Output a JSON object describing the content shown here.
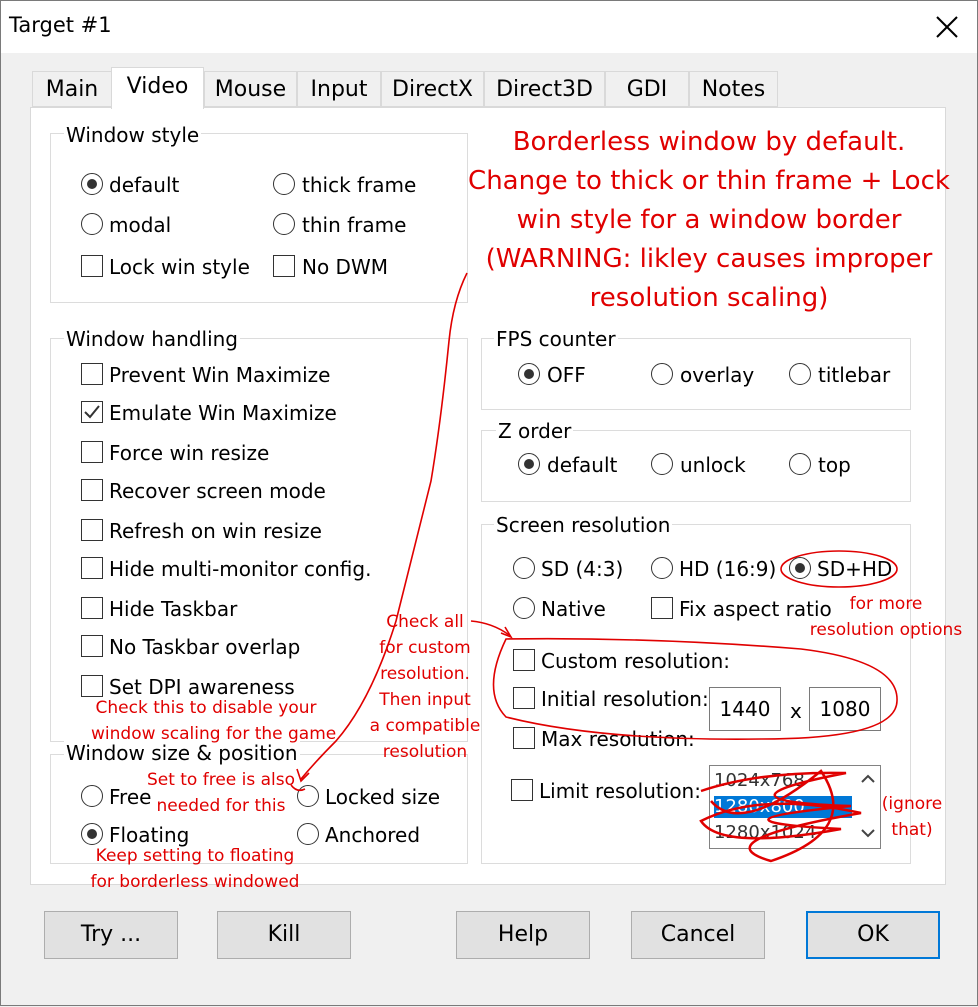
{
  "window": {
    "title": "Target #1"
  },
  "tabs": [
    "Main",
    "Video",
    "Mouse",
    "Input",
    "DirectX",
    "Direct3D",
    "GDI",
    "Notes"
  ],
  "window_style": {
    "label": "Window style",
    "default": "default",
    "thick_frame": "thick frame",
    "modal": "modal",
    "thin_frame": "thin frame",
    "lock_win_style": "Lock win style",
    "no_dwm": "No DWM"
  },
  "window_handling": {
    "label": "Window handling",
    "items": [
      "Prevent Win Maximize",
      "Emulate Win Maximize",
      "Force win resize",
      "Recover screen mode",
      "Refresh on win resize",
      "Hide multi-monitor config.",
      "Hide Taskbar",
      "No Taskbar overlap",
      "Set DPI awareness"
    ]
  },
  "window_size": {
    "label": "Window size & position",
    "free": "Free",
    "locked_size": "Locked size",
    "floating": "Floating",
    "anchored": "Anchored"
  },
  "fps": {
    "label": "FPS counter",
    "off": "OFF",
    "overlay": "overlay",
    "titlebar": "titlebar"
  },
  "zorder": {
    "label": "Z order",
    "default": "default",
    "unlock": "unlock",
    "top": "top"
  },
  "screen_res": {
    "label": "Screen resolution",
    "sd": "SD (4:3)",
    "hd": "HD (16:9)",
    "sdhd": "SD+HD",
    "native": "Native",
    "fix_aspect": "Fix aspect ratio",
    "custom": "Custom resolution:",
    "initial": "Initial resolution:",
    "width": "1440",
    "x": "x",
    "height": "1080",
    "max": "Max resolution:",
    "limit": "Limit  resolution:",
    "limit_options": [
      "1024x768",
      "1280x800",
      "1280x1024"
    ]
  },
  "buttons": {
    "try": "Try ...",
    "kill": "Kill",
    "help": "Help",
    "cancel": "Cancel",
    "ok": "OK"
  },
  "annotations": {
    "borderless": [
      "Borderless window by default.",
      "Change to thick or thin frame + Lock",
      "win style for a window border",
      "(WARNING: likley causes improper",
      "resolution scaling)"
    ],
    "check_all": [
      "Check all",
      "for custom",
      "resolution.",
      "Then  input",
      "a compatible",
      "resolution"
    ],
    "more_res": [
      "for more",
      "resolution options"
    ],
    "ignore": [
      "(ignore",
      "that)"
    ],
    "dpi": [
      "Check this to disable your",
      "window scaling for the game"
    ],
    "free_needed": [
      "Set to free is also",
      "needed for this"
    ],
    "floating": [
      "Keep setting to floating",
      "for borderless windowed"
    ]
  },
  "colors": {
    "annotation": "#e00000",
    "selection": "#0078d7",
    "default_border": "#0078d7"
  }
}
